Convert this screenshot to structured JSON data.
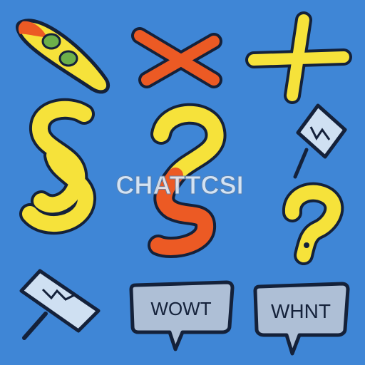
{
  "background_color": "#3f86d6",
  "palette": {
    "yellow": "#f6e23a",
    "orange": "#ec5a24",
    "red": "#e04a1c",
    "green": "#6db04a",
    "outline": "#14213a",
    "sign_fill": "#cfe0f2",
    "bubble_fill": "#aebfd6"
  },
  "icons": [
    "surfboard-icon",
    "x-mark-icon",
    "plus-icon",
    "section-sign-icon",
    "question-mark-icon",
    "sign-board-icon",
    "question-mark-icon",
    "sign-board-icon",
    "speech-bubble-icon",
    "speech-bubble-icon"
  ],
  "texts": {
    "center_label": "CHATTCSI",
    "bubble_middle": "WOWT",
    "bubble_right": "WHNT"
  }
}
